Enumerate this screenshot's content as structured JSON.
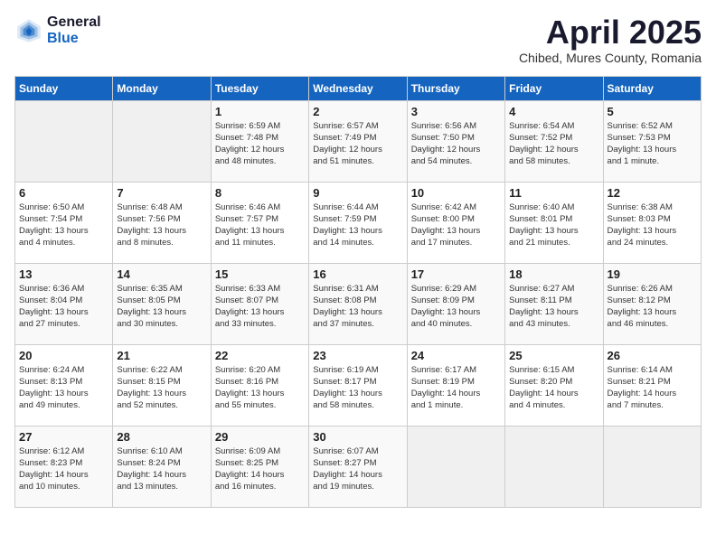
{
  "header": {
    "logo_general": "General",
    "logo_blue": "Blue",
    "month_title": "April 2025",
    "subtitle": "Chibed, Mures County, Romania"
  },
  "weekdays": [
    "Sunday",
    "Monday",
    "Tuesday",
    "Wednesday",
    "Thursday",
    "Friday",
    "Saturday"
  ],
  "weeks": [
    [
      {
        "day": "",
        "info": ""
      },
      {
        "day": "",
        "info": ""
      },
      {
        "day": "1",
        "info": "Sunrise: 6:59 AM\nSunset: 7:48 PM\nDaylight: 12 hours\nand 48 minutes."
      },
      {
        "day": "2",
        "info": "Sunrise: 6:57 AM\nSunset: 7:49 PM\nDaylight: 12 hours\nand 51 minutes."
      },
      {
        "day": "3",
        "info": "Sunrise: 6:56 AM\nSunset: 7:50 PM\nDaylight: 12 hours\nand 54 minutes."
      },
      {
        "day": "4",
        "info": "Sunrise: 6:54 AM\nSunset: 7:52 PM\nDaylight: 12 hours\nand 58 minutes."
      },
      {
        "day": "5",
        "info": "Sunrise: 6:52 AM\nSunset: 7:53 PM\nDaylight: 13 hours\nand 1 minute."
      }
    ],
    [
      {
        "day": "6",
        "info": "Sunrise: 6:50 AM\nSunset: 7:54 PM\nDaylight: 13 hours\nand 4 minutes."
      },
      {
        "day": "7",
        "info": "Sunrise: 6:48 AM\nSunset: 7:56 PM\nDaylight: 13 hours\nand 8 minutes."
      },
      {
        "day": "8",
        "info": "Sunrise: 6:46 AM\nSunset: 7:57 PM\nDaylight: 13 hours\nand 11 minutes."
      },
      {
        "day": "9",
        "info": "Sunrise: 6:44 AM\nSunset: 7:59 PM\nDaylight: 13 hours\nand 14 minutes."
      },
      {
        "day": "10",
        "info": "Sunrise: 6:42 AM\nSunset: 8:00 PM\nDaylight: 13 hours\nand 17 minutes."
      },
      {
        "day": "11",
        "info": "Sunrise: 6:40 AM\nSunset: 8:01 PM\nDaylight: 13 hours\nand 21 minutes."
      },
      {
        "day": "12",
        "info": "Sunrise: 6:38 AM\nSunset: 8:03 PM\nDaylight: 13 hours\nand 24 minutes."
      }
    ],
    [
      {
        "day": "13",
        "info": "Sunrise: 6:36 AM\nSunset: 8:04 PM\nDaylight: 13 hours\nand 27 minutes."
      },
      {
        "day": "14",
        "info": "Sunrise: 6:35 AM\nSunset: 8:05 PM\nDaylight: 13 hours\nand 30 minutes."
      },
      {
        "day": "15",
        "info": "Sunrise: 6:33 AM\nSunset: 8:07 PM\nDaylight: 13 hours\nand 33 minutes."
      },
      {
        "day": "16",
        "info": "Sunrise: 6:31 AM\nSunset: 8:08 PM\nDaylight: 13 hours\nand 37 minutes."
      },
      {
        "day": "17",
        "info": "Sunrise: 6:29 AM\nSunset: 8:09 PM\nDaylight: 13 hours\nand 40 minutes."
      },
      {
        "day": "18",
        "info": "Sunrise: 6:27 AM\nSunset: 8:11 PM\nDaylight: 13 hours\nand 43 minutes."
      },
      {
        "day": "19",
        "info": "Sunrise: 6:26 AM\nSunset: 8:12 PM\nDaylight: 13 hours\nand 46 minutes."
      }
    ],
    [
      {
        "day": "20",
        "info": "Sunrise: 6:24 AM\nSunset: 8:13 PM\nDaylight: 13 hours\nand 49 minutes."
      },
      {
        "day": "21",
        "info": "Sunrise: 6:22 AM\nSunset: 8:15 PM\nDaylight: 13 hours\nand 52 minutes."
      },
      {
        "day": "22",
        "info": "Sunrise: 6:20 AM\nSunset: 8:16 PM\nDaylight: 13 hours\nand 55 minutes."
      },
      {
        "day": "23",
        "info": "Sunrise: 6:19 AM\nSunset: 8:17 PM\nDaylight: 13 hours\nand 58 minutes."
      },
      {
        "day": "24",
        "info": "Sunrise: 6:17 AM\nSunset: 8:19 PM\nDaylight: 14 hours\nand 1 minute."
      },
      {
        "day": "25",
        "info": "Sunrise: 6:15 AM\nSunset: 8:20 PM\nDaylight: 14 hours\nand 4 minutes."
      },
      {
        "day": "26",
        "info": "Sunrise: 6:14 AM\nSunset: 8:21 PM\nDaylight: 14 hours\nand 7 minutes."
      }
    ],
    [
      {
        "day": "27",
        "info": "Sunrise: 6:12 AM\nSunset: 8:23 PM\nDaylight: 14 hours\nand 10 minutes."
      },
      {
        "day": "28",
        "info": "Sunrise: 6:10 AM\nSunset: 8:24 PM\nDaylight: 14 hours\nand 13 minutes."
      },
      {
        "day": "29",
        "info": "Sunrise: 6:09 AM\nSunset: 8:25 PM\nDaylight: 14 hours\nand 16 minutes."
      },
      {
        "day": "30",
        "info": "Sunrise: 6:07 AM\nSunset: 8:27 PM\nDaylight: 14 hours\nand 19 minutes."
      },
      {
        "day": "",
        "info": ""
      },
      {
        "day": "",
        "info": ""
      },
      {
        "day": "",
        "info": ""
      }
    ]
  ]
}
